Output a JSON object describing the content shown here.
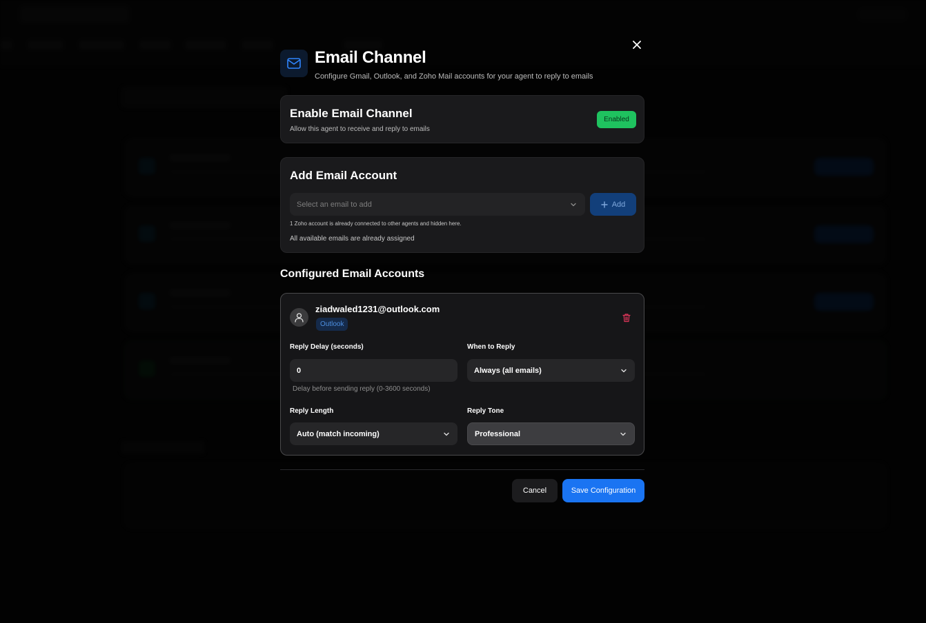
{
  "modal": {
    "title": "Email Channel",
    "subtitle": "Configure Gmail, Outlook, and Zoho Mail accounts for your agent to reply to emails",
    "icon": "mail-icon"
  },
  "enable_card": {
    "title": "Enable Email Channel",
    "description": "Allow this agent to receive and reply to emails",
    "status": "Enabled"
  },
  "add_card": {
    "title": "Add Email Account",
    "select_placeholder": "Select an email to add",
    "add_label": "Add",
    "note_hidden": "1 Zoho account is already connected to other agents and hidden here.",
    "note_assigned": "All available emails are already assigned"
  },
  "configured": {
    "title": "Configured Email Accounts",
    "accounts": [
      {
        "email": "ziadwaled1231@outlook.com",
        "provider": "Outlook",
        "reply_delay_label": "Reply Delay (seconds)",
        "reply_delay_value": "0",
        "reply_delay_hint": "Delay before sending reply (0-3600 seconds)",
        "when_label": "When to Reply",
        "when_value": "Always (all emails)",
        "length_label": "Reply Length",
        "length_value": "Auto (match incoming)",
        "tone_label": "Reply Tone",
        "tone_value": "Professional"
      }
    ]
  },
  "footer": {
    "cancel_label": "Cancel",
    "save_label": "Save Configuration"
  },
  "colors": {
    "enabled_green": "#1fc25f",
    "primary_blue": "#1a74f2",
    "provider_badge": "#4d8fe0",
    "delete_red": "#e0365a"
  }
}
